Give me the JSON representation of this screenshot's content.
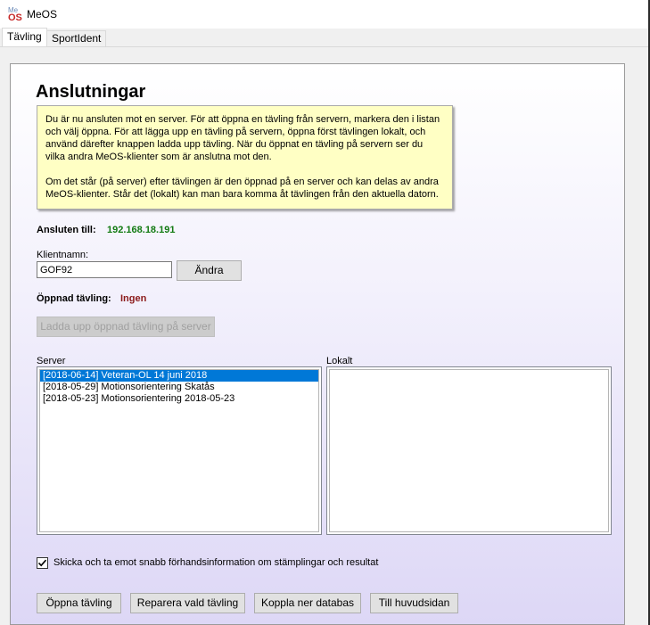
{
  "window": {
    "title": "MeOS"
  },
  "tabs": [
    {
      "label": "Tävling",
      "active": true
    },
    {
      "label": "SportIdent",
      "active": false
    }
  ],
  "page": {
    "heading": "Anslutningar",
    "info_paragraph_1": "Du är nu ansluten mot en server. För att öppna en tävling från servern, markera den i listan och välj öppna. För att lägga upp en tävling på servern, öppna först tävlingen lokalt, och använd därefter knappen ladda upp tävling. När du öppnat en tävling på servern ser du vilka andra MeOS-klienter som är anslutna mot den.",
    "info_paragraph_2": "Om det står (på server) efter tävlingen är den öppnad på en server och kan delas av andra MeOS-klienter. Står det (lokalt) kan man bara komma åt tävlingen från den aktuella datorn.",
    "connected_label": "Ansluten till:",
    "connected_value": "192.168.18.191",
    "client_name_label": "Klientnamn:",
    "client_name_value": "GOF92",
    "change_button": "Ändra",
    "opened_label": "Öppnad tävling:",
    "opened_value": "Ingen",
    "upload_button": "Ladda upp öppnad tävling på server",
    "server_label": "Server",
    "local_label": "Lokalt",
    "server_list": [
      "[2018-06-14] Veteran-OL 14 juni 2018",
      "[2018-05-29] Motionsorientering Skatås",
      "[2018-05-23] Motionsorientering 2018-05-23"
    ],
    "server_selected_index": 0,
    "local_list": [],
    "checkbox_label": "Skicka och ta emot snabb förhandsinformation om stämplingar och resultat",
    "checkbox_checked": true,
    "buttons": {
      "open": "Öppna tävling",
      "repair": "Reparera vald tävling",
      "disconnect": "Koppla ner databas",
      "main": "Till huvudsidan"
    }
  },
  "colors": {
    "connected_value": "#127a12",
    "opened_value": "#8b1a1a",
    "selection": "#0078d7",
    "info_bg": "#ffffc4"
  }
}
